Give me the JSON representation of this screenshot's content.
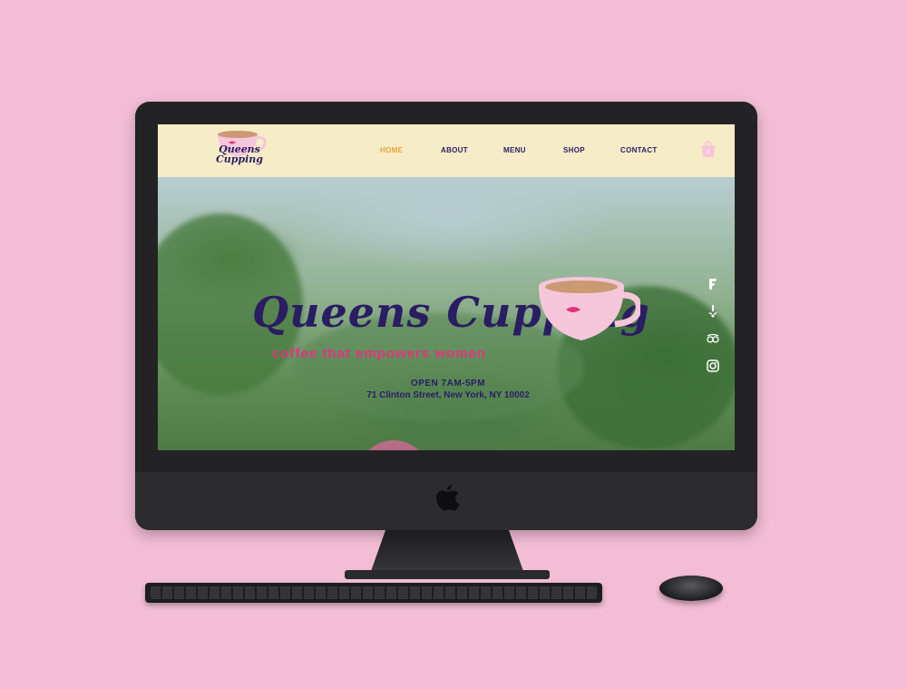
{
  "nav": {
    "items": [
      {
        "label": "HOME",
        "active": true
      },
      {
        "label": "ABOUT",
        "active": false
      },
      {
        "label": "MENU",
        "active": false
      },
      {
        "label": "SHOP",
        "active": false
      },
      {
        "label": "CONTACT",
        "active": false
      }
    ]
  },
  "logo": {
    "line1": "Queens",
    "line2": "Cupping"
  },
  "hero": {
    "title": "Queens Cupping",
    "tagline": "coffee that empowers women",
    "hours": "OPEN 7AM-5PM",
    "address": "71 Clinton Street, New York, NY 10002"
  },
  "social": [
    "foursquare-icon",
    "yelp-icon",
    "tripadvisor-icon",
    "instagram-icon"
  ],
  "colors": {
    "background": "#f2bdd5",
    "header": "#f7ecc8",
    "navy": "#2a1d63",
    "accent": "#e6a43a",
    "pink": "#e5337f",
    "cup": "#f6c6da"
  }
}
